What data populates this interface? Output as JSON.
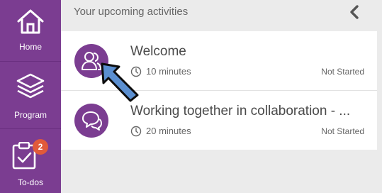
{
  "sidebar": {
    "items": [
      {
        "label": "Home",
        "icon": "home-icon"
      },
      {
        "label": "Program",
        "icon": "layers-icon"
      },
      {
        "label": "To-dos",
        "icon": "clipboard-check-icon",
        "badge": "2"
      }
    ]
  },
  "panel": {
    "title": "Your upcoming activities",
    "back_icon": "chevron-left-icon"
  },
  "activities": [
    {
      "title": "Welcome",
      "duration": "10 minutes",
      "status": "Not Started",
      "icon": "users-icon"
    },
    {
      "title": "Working together in collaboration - ...",
      "duration": "20 minutes",
      "status": "Not Started",
      "icon": "chat-bubbles-icon"
    }
  ],
  "colors": {
    "sidebar": "#7b3d91",
    "accent": "#7b3d91",
    "badge": "#e05a3a",
    "pointer": "#5b8fd0"
  }
}
